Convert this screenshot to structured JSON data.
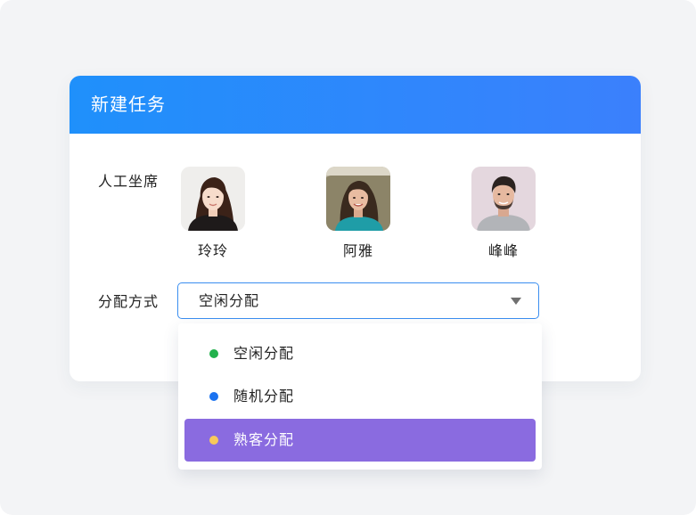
{
  "dialog": {
    "title": "新建任务"
  },
  "agents_section": {
    "label": "人工坐席",
    "agents": [
      {
        "name": "玲玲",
        "avatar": "woman-long-dark-hair-photo"
      },
      {
        "name": "阿雅",
        "avatar": "woman-outdoor-portrait-photo"
      },
      {
        "name": "峰峰",
        "avatar": "man-beard-portrait-photo"
      }
    ]
  },
  "assignment": {
    "label": "分配方式",
    "selected_value": "空闲分配",
    "caret_icon": "triangle-down-icon",
    "options": [
      {
        "label": "空闲分配",
        "dot_color": "#22b14c",
        "selected": false
      },
      {
        "label": "随机分配",
        "dot_color": "#1b73f0",
        "selected": false
      },
      {
        "label": "熟客分配",
        "dot_color": "#f8c95b",
        "selected": true
      }
    ]
  },
  "colors": {
    "header_gradient_start": "#1f90fb",
    "header_gradient_end": "#3b80fc",
    "selected_option_bg": "#8a6be0",
    "select_border": "#3a8ef0"
  }
}
